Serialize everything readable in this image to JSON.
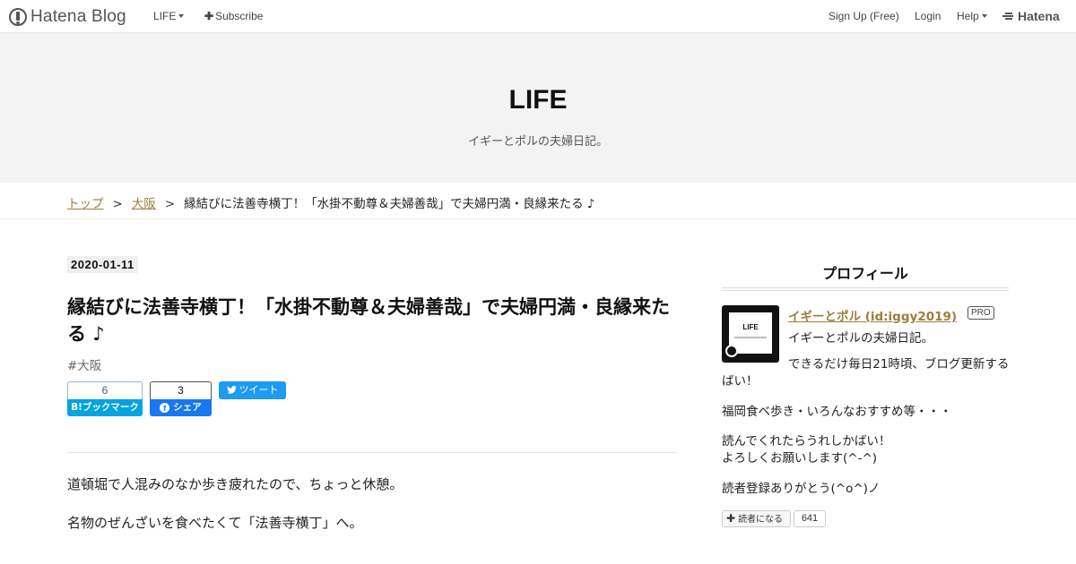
{
  "topbar": {
    "logo_text": "Hatena Blog",
    "blog_menu": "LIFE",
    "subscribe": "Subscribe",
    "signup": "Sign Up (Free)",
    "login": "Login",
    "help": "Help",
    "hatena": "Hatena"
  },
  "header": {
    "title": "LIFE",
    "description": "イギーとポルの夫婦日記。"
  },
  "breadcrumb": {
    "top": "トップ",
    "sep": ">",
    "category": "大阪",
    "current": "縁結びに法善寺横丁！「水掛不動尊＆夫婦善哉」で夫婦円満・良縁来たる ♪"
  },
  "entry": {
    "date": "2020-01-11",
    "title": "縁結びに法善寺横丁！「水掛不動尊＆夫婦善哉」で夫婦円満・良縁来たる ♪",
    "category": "#大阪",
    "paragraphs": [
      "道頓堀で人混みのなか歩き疲れたので、ちょっと休憩。",
      "名物のぜんざいを食べたくて「法善寺横丁」へ。"
    ]
  },
  "share": {
    "hatebu_count": "6",
    "hatebu_label": "B!ブックマーク",
    "fb_count": "3",
    "fb_label": "シェア",
    "fb_icon": "f",
    "tweet_label": "ツイート"
  },
  "sidebar": {
    "heading": "プロフィール",
    "avatar_text": "LIFE",
    "name": "イギーとポル (id:iggy2019)",
    "badge": "PRO",
    "subtitle": "イギーとポルの夫婦日記。",
    "bio": [
      "できるだけ毎日21時頃、ブログ更新するばい！",
      "福岡食べ歩き・いろんなおすすめ等・・・",
      "読んでくれたらうれしかばい！\nよろしくお願いします(^-^)",
      "読者登録ありがとう(^o^)ノ"
    ],
    "reader_button": "読者になる",
    "reader_count": "641"
  },
  "icons": {
    "logo": "hatena-blog-logo-icon",
    "caret": "caret-down-icon",
    "plus": "plus-icon",
    "twitter": "twitter-bird-icon",
    "facebook": "facebook-icon"
  },
  "colors": {
    "link": "#9a7f3d",
    "hatebu": "#00a4de",
    "facebook": "#1877f2",
    "twitter": "#1d9bf0",
    "header_bg": "#f3f3f3"
  }
}
